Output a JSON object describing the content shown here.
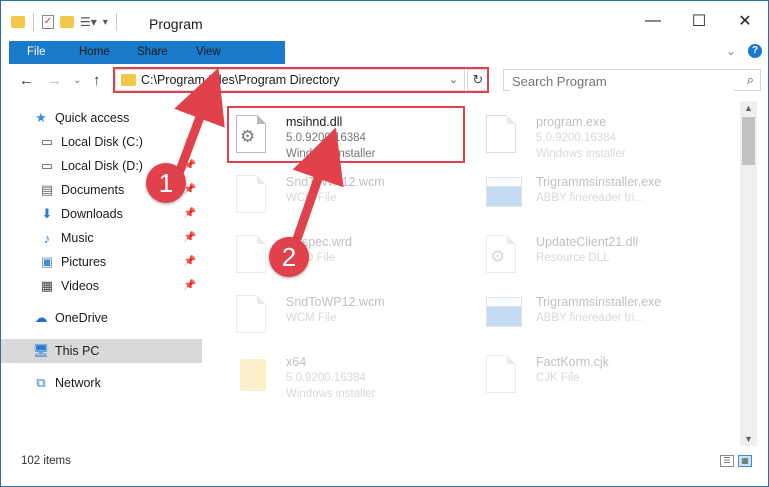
{
  "window": {
    "title": "Program",
    "controls": {
      "minimize": "—",
      "maximize": "☐",
      "close": "✕"
    }
  },
  "ribbon": {
    "tabs": [
      "File",
      "Home",
      "Share",
      "View"
    ],
    "help_label": "?"
  },
  "nav": {
    "address_path": "C:\\Program Files\\Program Directory",
    "search_placeholder": "Search Program"
  },
  "sidebar": {
    "items": [
      {
        "label": "Quick access",
        "icon": "star-icon",
        "pinned": false
      },
      {
        "label": "Local Disk (C:)",
        "icon": "drive-icon",
        "pinned": true
      },
      {
        "label": "Local Disk (D:)",
        "icon": "drive-icon",
        "pinned": true
      },
      {
        "label": "Documents",
        "icon": "documents-icon",
        "pinned": true
      },
      {
        "label": "Downloads",
        "icon": "download-icon",
        "pinned": true
      },
      {
        "label": "Music",
        "icon": "music-icon",
        "pinned": true
      },
      {
        "label": "Pictures",
        "icon": "pictures-icon",
        "pinned": true
      },
      {
        "label": "Videos",
        "icon": "videos-icon",
        "pinned": true
      },
      {
        "label": "OneDrive",
        "icon": "cloud-icon",
        "pinned": false
      },
      {
        "label": "This PC",
        "icon": "computer-icon",
        "pinned": false,
        "selected": true
      },
      {
        "label": "Network",
        "icon": "network-icon",
        "pinned": false
      }
    ]
  },
  "files": [
    {
      "name": "msihnd.dll",
      "version": "5.0.9200.16384",
      "type": "Windows installer",
      "icon": "settings-file-icon",
      "highlighted": true
    },
    {
      "name": "program.exe",
      "version": "5.0.9200.16384",
      "type": "Windows installer",
      "icon": "exe-icon"
    },
    {
      "name": "SndToWP12.wcm",
      "version": "",
      "type": "WCM File",
      "icon": "file-icon"
    },
    {
      "name": "Trigrammsinstaller.exe",
      "version": "",
      "type": "ABBY finereader tri...",
      "icon": "installer-icon"
    },
    {
      "name": "Ruspec.wrd",
      "version": "",
      "type": "WRD File",
      "icon": "file-icon"
    },
    {
      "name": "UpdateClient21.dll",
      "version": "",
      "type": "Resource DLL",
      "icon": "settings-file-icon"
    },
    {
      "name": "SndToWP12.wcm",
      "version": "",
      "type": "WCM File",
      "icon": "file-icon"
    },
    {
      "name": "Trigrammsinstaller.exe",
      "version": "",
      "type": "ABBY finereader tri...",
      "icon": "installer-icon"
    },
    {
      "name": "x64",
      "version": "5.0.9200.16384",
      "type": "Windows installer",
      "icon": "folder-icon"
    },
    {
      "name": "FactKorm.cjk",
      "version": "",
      "type": "CJK File",
      "icon": "file-icon"
    }
  ],
  "status": {
    "item_count": "102 items"
  },
  "annotations": {
    "step1": "1",
    "step2": "2"
  },
  "colors": {
    "accent": "#1979ca",
    "highlight": "#e0414a"
  }
}
